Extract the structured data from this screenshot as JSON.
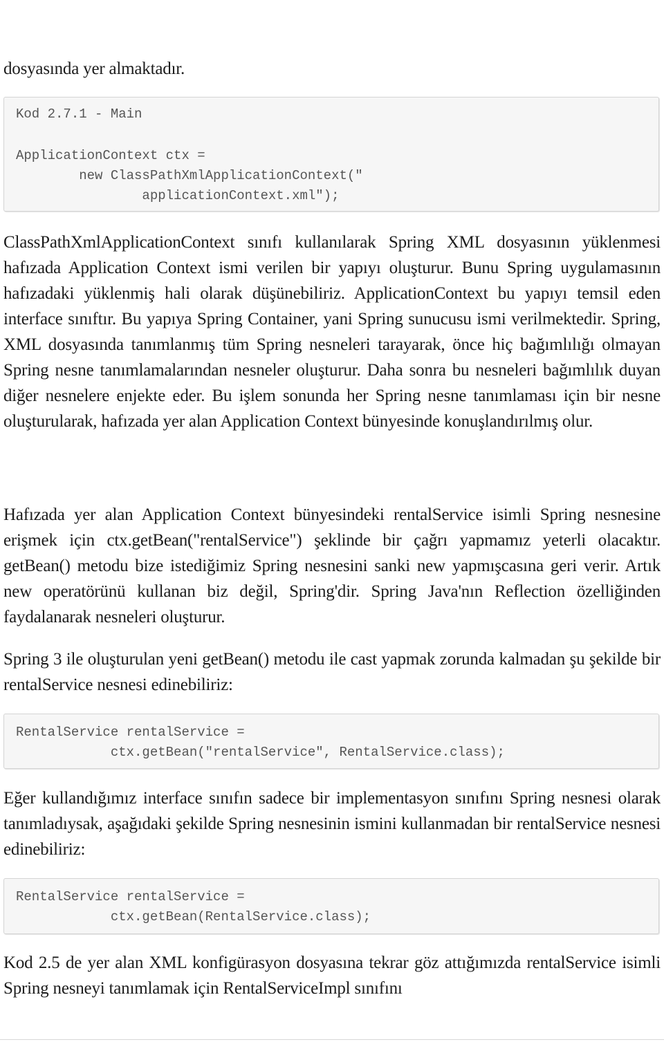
{
  "paragraphs": {
    "p0": "dosyasında yer almaktadır.",
    "p1": "ClassPathXmlApplicationContext sınıfı kullanılarak Spring XML dosyasının yüklenmesi hafızada Application Context ismi verilen bir yapıyı oluşturur. Bunu Spring uygulamasının hafızadaki yüklenmiş hali olarak düşünebiliriz. ApplicationContext bu yapıyı temsil eden interface sınıftır. Bu yapıya Spring Container, yani Spring sunucusu ismi verilmektedir. Spring, XML dosyasında tanımlanmış tüm Spring nesneleri tarayarak, önce hiç bağımlılığı olmayan Spring nesne tanımlamalarından nesneler oluşturur. Daha sonra bu nesneleri bağımlılık duyan diğer nesnelere enjekte eder. Bu işlem sonunda her Spring nesne tanımlaması için bir nesne oluşturularak, hafızada yer alan Application Context bünyesinde konuşlandırılmış olur.",
    "p2": "Hafızada yer alan Application Context bünyesindeki rentalService isimli Spring nesnesine erişmek için ctx.getBean(\"rentalService\") şeklinde bir çağrı yapmamız yeterli olacaktır. getBean() metodu bize istediğimiz Spring nesnesini sanki new yapmışcasına geri verir. Artık new operatörünü kullanan biz değil, Spring'dir. Spring Java'nın Reflection özelliğinden faydalanarak nesneleri oluşturur.",
    "p3": "Spring 3 ile oluşturulan yeni getBean() metodu ile cast yapmak zorunda kalmadan şu şekilde bir rentalService nesnesi edinebiliriz:",
    "p4": "Eğer kullandığımız interface sınıfın sadece bir implementasyon sınıfını Spring nesnesi olarak tanımladıysak, aşağıdaki şekilde Spring nesnesinin ismini kullanmadan bir rentalService nesnesi edinebiliriz:",
    "p5": "Kod 2.5 de yer alan XML konfigürasyon dosyasına tekrar göz attığımızda rentalService isimli Spring nesneyi tanımlamak için RentalServiceImpl sınıfını"
  },
  "code_blocks": [
    {
      "caption": "Kod 2.7.1 - Main",
      "lines": [
        "ApplicationContext ctx =",
        "        new ClassPathXmlApplicationContext(\"",
        "                applicationContext.xml\");"
      ]
    },
    {
      "lines": [
        "RentalService rentalService =",
        "            ctx.getBean(\"rentalService\", RentalService.class);"
      ]
    },
    {
      "lines": [
        "RentalService rentalService =",
        "            ctx.getBean(RentalService.class);"
      ]
    }
  ]
}
